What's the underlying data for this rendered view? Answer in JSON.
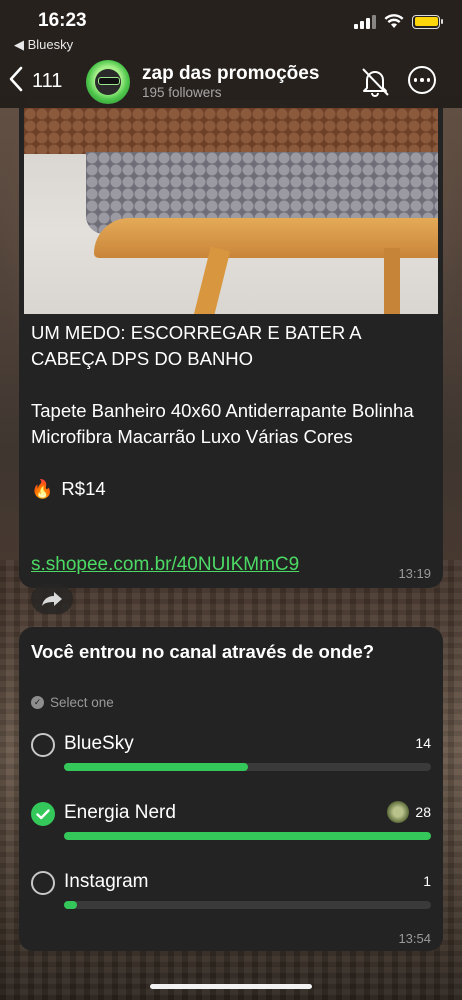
{
  "status_bar": {
    "time": "16:23",
    "back_app": "◀ Bluesky",
    "battery_color": "#ffd60a"
  },
  "header": {
    "back_count": "111",
    "channel_name": "zap das promoções",
    "followers": "195 followers",
    "icons": [
      "chevron-left-icon",
      "bell-slash-icon",
      "more-icon"
    ]
  },
  "post": {
    "title": "UM MEDO: ESCORREGAR E BATER A CABEÇA DPS DO BANHO",
    "description": "Tapete Banheiro 40x60 Antiderrapante Bolinha Microfibra Macarrão Luxo Várias Cores",
    "price_emoji": "🔥",
    "price": "R$14",
    "link": "s.shopee.com.br/40NUIKMmC9",
    "time": "13:19",
    "link_color": "#4cd964"
  },
  "poll": {
    "question": "Você entrou no canal através de onde?",
    "hint": "Select one",
    "options": [
      {
        "label": "BlueSky",
        "votes": "14",
        "fraction": 0.5,
        "selected": false
      },
      {
        "label": "Energia Nerd",
        "votes": "28",
        "fraction": 1.0,
        "selected": true
      },
      {
        "label": "Instagram",
        "votes": "1",
        "fraction": 0.036,
        "selected": false
      }
    ],
    "time": "13:54",
    "bar_color": "#34c759"
  }
}
